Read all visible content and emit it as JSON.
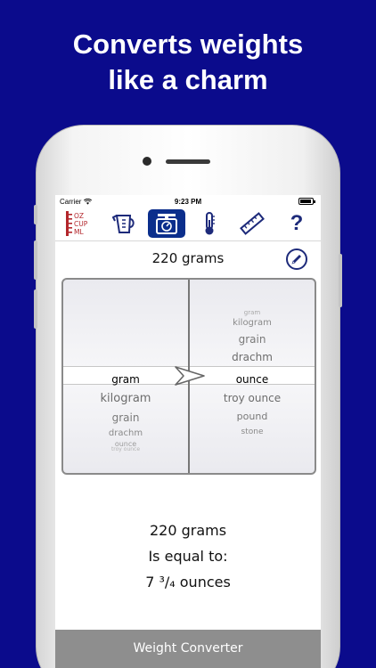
{
  "headline": {
    "line1": "Converts weights",
    "line2": "like a charm"
  },
  "status_bar": {
    "carrier": "Carrier",
    "time": "9:23 PM"
  },
  "toolbar": {
    "items": [
      {
        "icon": "oz-cup-ml-icon",
        "lines": [
          "OZ",
          "CUP",
          "ML"
        ],
        "active": false
      },
      {
        "icon": "measuring-cup-icon",
        "active": false
      },
      {
        "icon": "scale-icon",
        "active": true
      },
      {
        "icon": "thermometer-icon",
        "active": false
      },
      {
        "icon": "ruler-icon",
        "active": false
      },
      {
        "icon": "help-icon",
        "label": "?",
        "active": false
      }
    ]
  },
  "amount_label": "220 grams",
  "picker": {
    "from_units": [
      "kilogram",
      "grain",
      "drachm",
      "ounce",
      "troy ounce"
    ],
    "from_selected": "gram",
    "to_units_above": [
      "gram",
      "kilogram",
      "grain",
      "drachm"
    ],
    "to_selected": "ounce",
    "to_units_below": [
      "troy ounce",
      "pound",
      "stone"
    ]
  },
  "result": {
    "line1": "220 grams",
    "line2": "Is equal to:",
    "line3": "7 ³/₄ ounces"
  },
  "footer_title": "Weight Converter",
  "colors": {
    "background": "#0b0b8c",
    "active_tool": "#0b2e8c",
    "icon_red": "#b3262b",
    "icon_blue": "#1d2a7a",
    "footer": "#8e8e8e"
  }
}
